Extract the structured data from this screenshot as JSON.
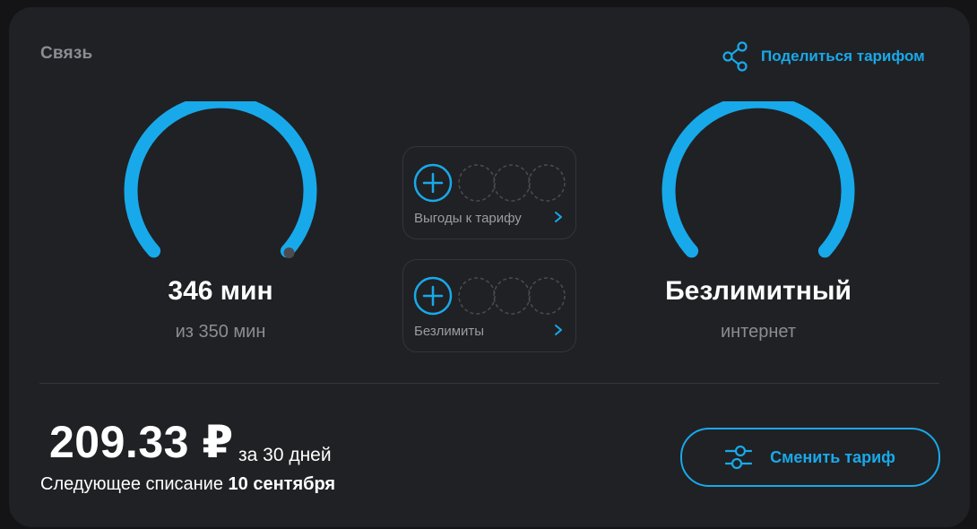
{
  "section": {
    "title": "Связь"
  },
  "share": {
    "label": "Поделиться тарифом",
    "icon": "share-icon"
  },
  "minutes": {
    "value": "346 мин",
    "subtitle": "из 350 мин",
    "used": 346,
    "total": 350
  },
  "internet": {
    "value": "Безлимитный",
    "subtitle": "интернет"
  },
  "addons": [
    {
      "label": "Выгоды к тарифу",
      "icon": "plus-icon"
    },
    {
      "label": "Безлимиты",
      "icon": "plus-icon"
    }
  ],
  "billing": {
    "price": "209.33 ₽",
    "period": "за 30 дней",
    "next_prefix": "Следующее списание",
    "next_date": "10 сентября"
  },
  "change_button": {
    "label": "Сменить тариф",
    "icon": "sliders-icon"
  },
  "colors": {
    "accent": "#18a9ea",
    "background": "#202124",
    "muted_text": "#8b8d92"
  }
}
